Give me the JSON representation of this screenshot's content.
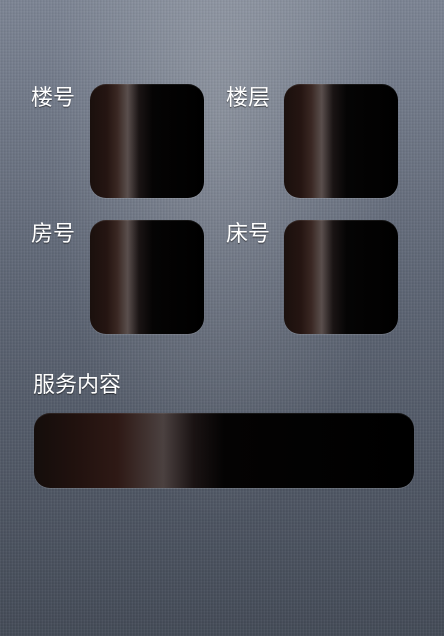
{
  "form": {
    "building_label": "楼号",
    "floor_label": "楼层",
    "room_label": "房号",
    "bed_label": "床号",
    "service_label": "服务内容",
    "building_value": "",
    "floor_value": "",
    "room_value": "",
    "bed_value": "",
    "service_value": ""
  }
}
